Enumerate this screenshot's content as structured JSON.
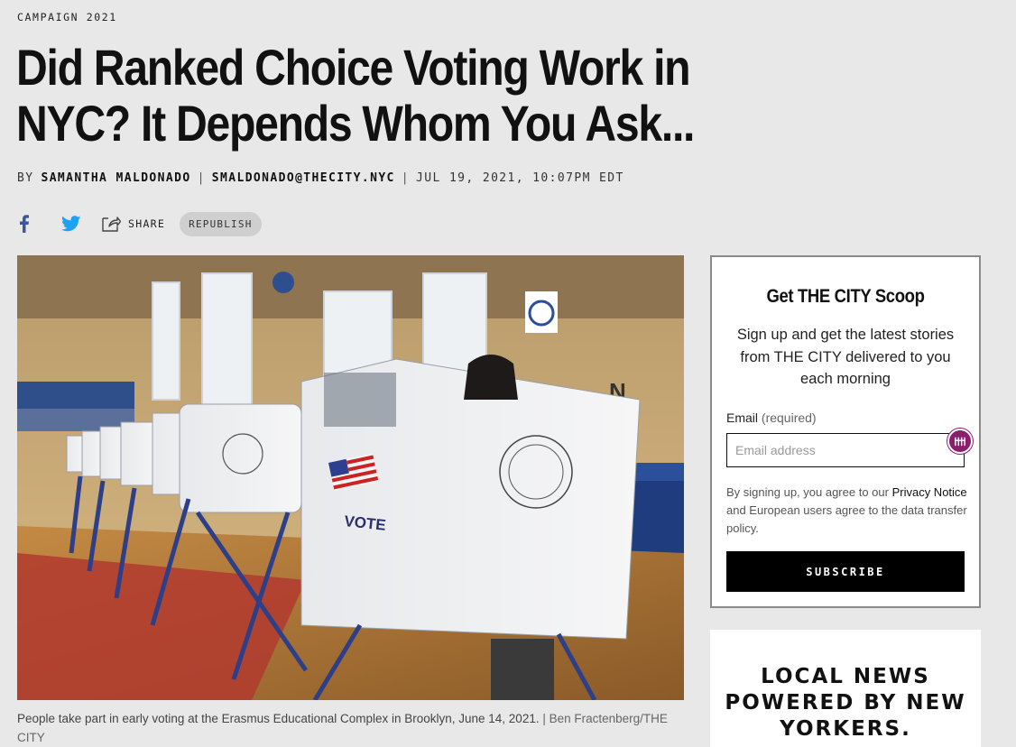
{
  "kicker": "CAMPAIGN 2021",
  "headline": "Did Ranked Choice Voting Work in NYC? It Depends Whom You Ask...",
  "byline": {
    "by": "BY",
    "author": "SAMANTHA MALDONADO",
    "email": "SMALDONADO@THECITY.NYC",
    "date": "JUL 19, 2021, 10:07PM EDT"
  },
  "share": {
    "share_label": "SHARE",
    "republish_label": "REPUBLISH"
  },
  "photo": {
    "vote_label": "VOTE",
    "n_sign": "N",
    "caption": "People take part in early voting at the Erasmus Educational Complex in Brooklyn, June 14, 2021.",
    "credit": "| Ben Fractenberg/THE CITY"
  },
  "signup": {
    "title": "Get THE CITY Scoop",
    "description": "Sign up and get the latest stories from THE CITY delivered to you each morning",
    "email_label": "Email",
    "email_required": "(required)",
    "email_placeholder": "Email address",
    "legal_prefix": "By signing up, you agree to our",
    "legal_link": "Privacy Notice",
    "legal_suffix": "and European users agree to the data transfer policy.",
    "subscribe_label": "SUBSCRIBE"
  },
  "promo": {
    "text": "LOCAL NEWS POWERED BY NEW YORKERS."
  },
  "colors": {
    "background": "#e8e8e8",
    "facebook": "#3b5998",
    "twitter": "#1da1f2",
    "subscribe_bg": "#000000",
    "badge": "#8a1f6e"
  }
}
